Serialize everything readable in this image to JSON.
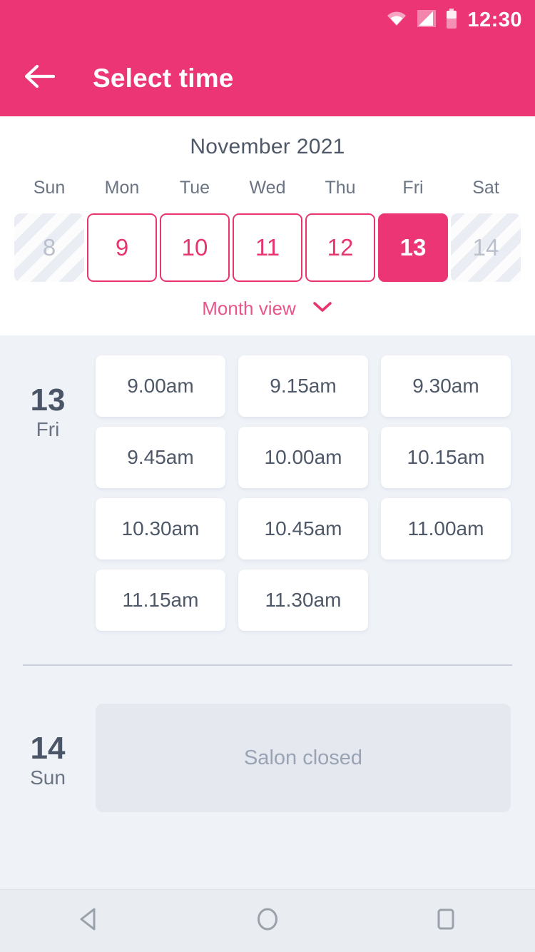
{
  "status_bar": {
    "time": "12:30",
    "icons": [
      "wifi-icon",
      "cell-signal-icon",
      "battery-icon"
    ]
  },
  "app_bar": {
    "back_icon": "arrow-left-icon",
    "title": "Select time"
  },
  "calendar": {
    "month_title": "November 2021",
    "weekday_headers": [
      "Sun",
      "Mon",
      "Tue",
      "Wed",
      "Thu",
      "Fri",
      "Sat"
    ],
    "days": [
      {
        "number": "8",
        "state": "disabled"
      },
      {
        "number": "9",
        "state": "available"
      },
      {
        "number": "10",
        "state": "available"
      },
      {
        "number": "11",
        "state": "available"
      },
      {
        "number": "12",
        "state": "available"
      },
      {
        "number": "13",
        "state": "selected"
      },
      {
        "number": "14",
        "state": "disabled"
      }
    ],
    "month_view_label": "Month view",
    "month_view_icon": "chevron-down-icon"
  },
  "schedule": [
    {
      "day_number": "13",
      "day_name": "Fri",
      "slots": [
        "9.00am",
        "9.15am",
        "9.30am",
        "9.45am",
        "10.00am",
        "10.15am",
        "10.30am",
        "10.45am",
        "11.00am",
        "11.15am",
        "11.30am"
      ]
    },
    {
      "day_number": "14",
      "day_name": "Sun",
      "closed_message": "Salon closed"
    }
  ],
  "nav_bar": {
    "back_icon": "triangle-back-icon",
    "home_icon": "circle-home-icon",
    "recents_icon": "square-recents-icon"
  },
  "colors": {
    "accent": "#ec3575",
    "accent_text": "#e8356d",
    "month_view_text": "#e8558a",
    "background": "#eff2f7",
    "card": "#ffffff",
    "text_dark": "#4a5568",
    "text_muted": "#6b7483",
    "disabled_text": "#b9c0cc",
    "closed_bg": "#e5e9ef",
    "closed_text": "#9aa3b4"
  }
}
